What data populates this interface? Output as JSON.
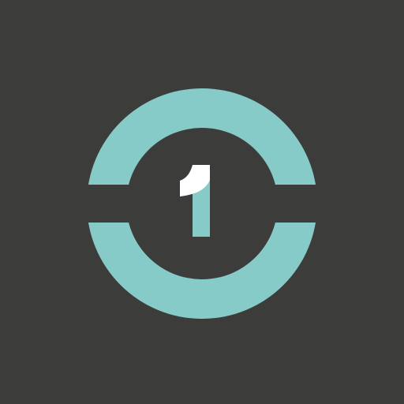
{
  "app_icon": {
    "name": "one-ring-logo",
    "background_color": "#3c3c3b",
    "ring_color": "#86cbc8",
    "numeral_color": "#86cbc8",
    "numeral_accent_color": "#ffffff",
    "numeral": "1"
  }
}
